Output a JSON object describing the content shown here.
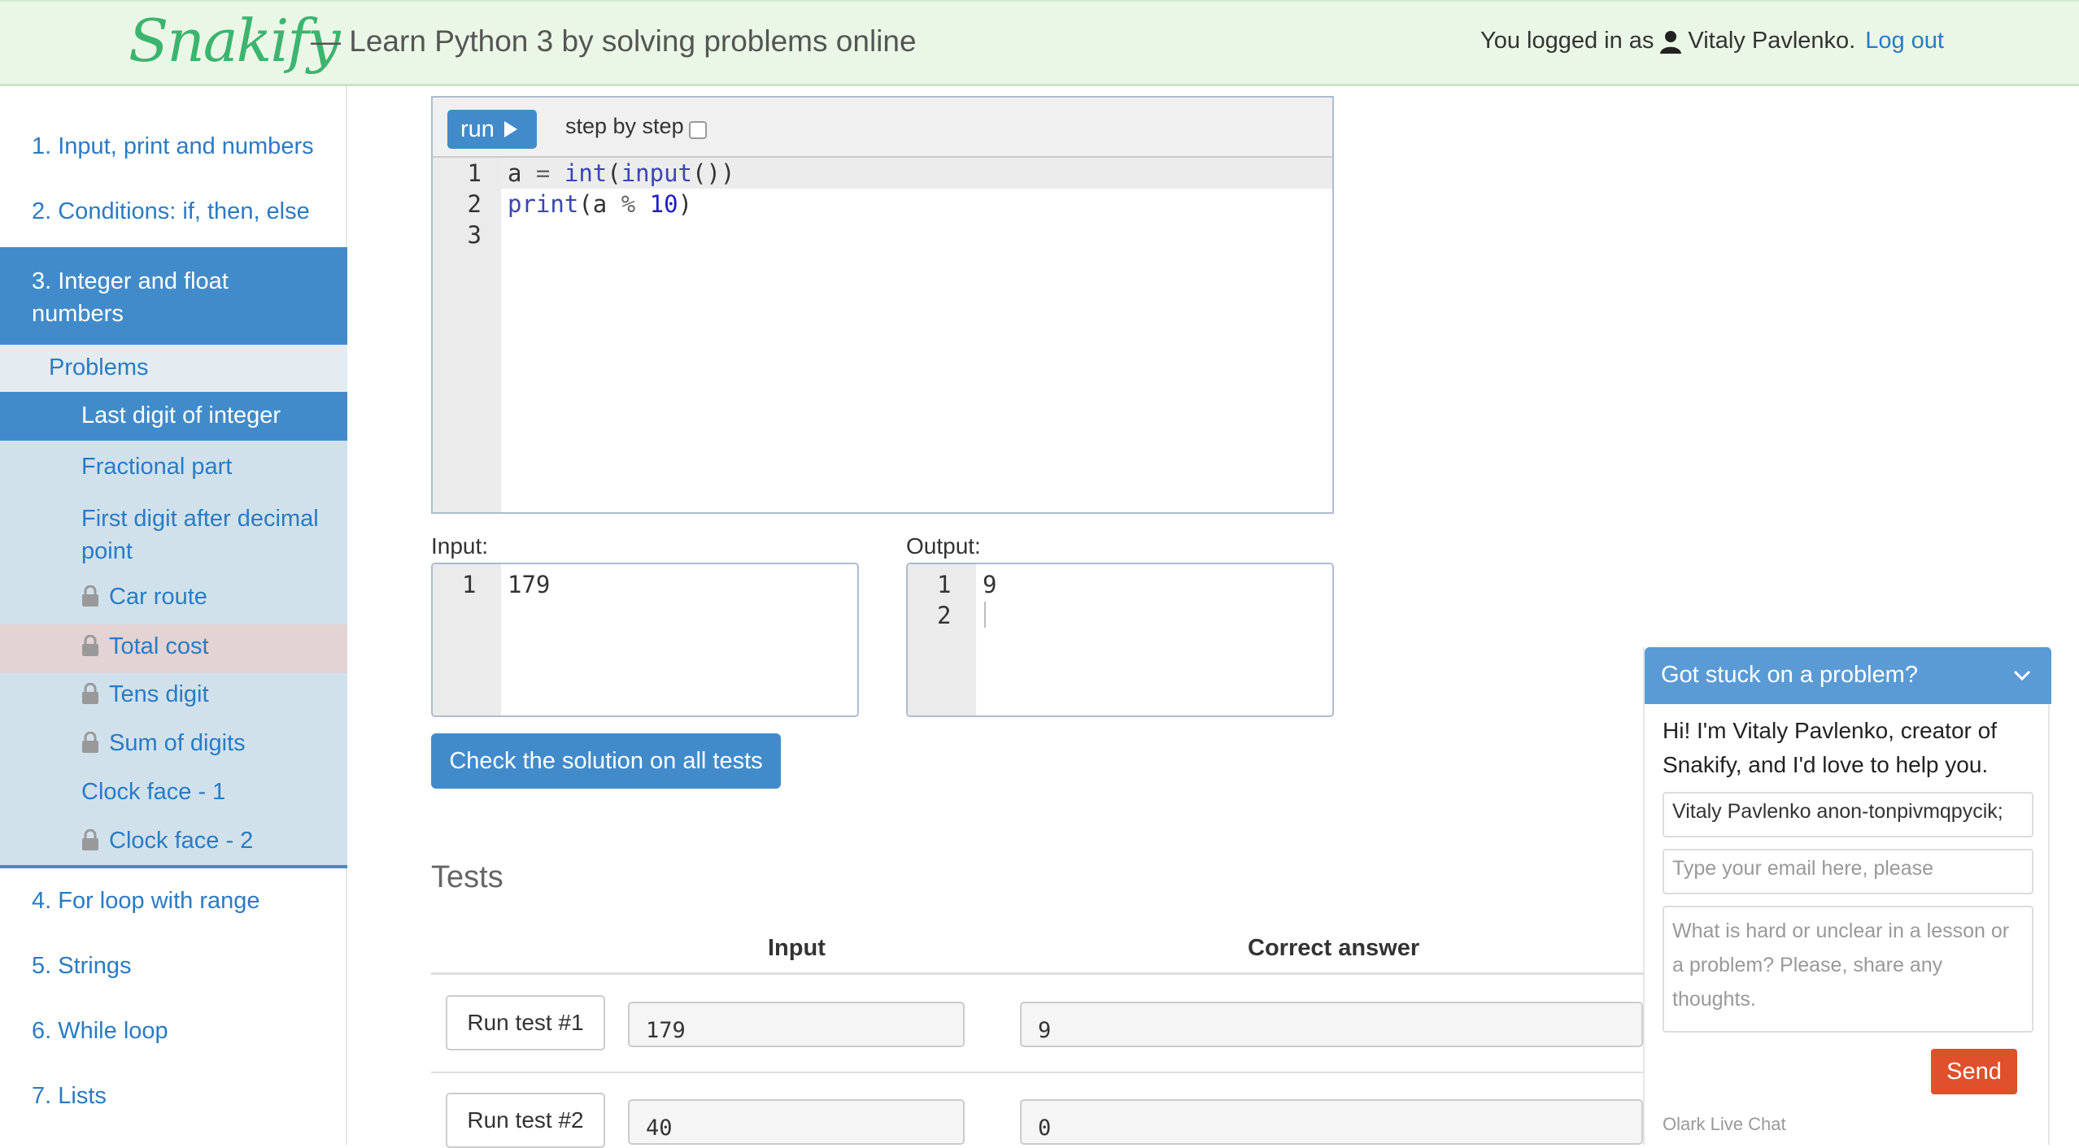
{
  "header": {
    "logo": "Snakify",
    "tagline": "— Learn Python 3 by solving problems online",
    "login_prefix": "You logged in as",
    "user_name": "Vitaly Pavlenko.",
    "logout": "Log out"
  },
  "sidebar": {
    "items": [
      {
        "label": "1. Input, print and numbers"
      },
      {
        "label": "2. Conditions: if, then, else"
      },
      {
        "label": "3. Integer and float numbers"
      },
      {
        "label": "4. For loop with range"
      },
      {
        "label": "5. Strings"
      },
      {
        "label": "6. While loop"
      },
      {
        "label": "7. Lists"
      }
    ],
    "problems_label": "Problems",
    "problems": [
      {
        "label": "Last digit of integer",
        "locked": false
      },
      {
        "label": "Fractional part",
        "locked": false
      },
      {
        "label": "First digit after decimal point",
        "locked": false
      },
      {
        "label": "Car route",
        "locked": true
      },
      {
        "label": "Total cost",
        "locked": true
      },
      {
        "label": "Tens digit",
        "locked": true
      },
      {
        "label": "Sum of digits",
        "locked": true
      },
      {
        "label": "Clock face - 1",
        "locked": false
      },
      {
        "label": "Clock face - 2",
        "locked": true
      }
    ]
  },
  "editor": {
    "run_label": "run",
    "step_label": "step by step",
    "line_numbers": [
      "1",
      "2",
      "3"
    ],
    "code_lines": [
      "a = int(input())",
      "print(a % 10)",
      ""
    ]
  },
  "io": {
    "input_label": "Input:",
    "output_label": "Output:",
    "input_lines": [
      {
        "n": "1",
        "text": "179"
      }
    ],
    "output_lines": [
      {
        "n": "1",
        "text": "9"
      },
      {
        "n": "2",
        "text": ""
      }
    ]
  },
  "check_button": "Check the solution on all tests",
  "tests": {
    "title": "Tests",
    "col_input": "Input",
    "col_answer": "Correct answer",
    "rows": [
      {
        "button": "Run test #1",
        "input": "179",
        "answer": "9"
      },
      {
        "button": "Run test #2",
        "input": "40",
        "answer": "0"
      }
    ]
  },
  "chat": {
    "title": "Got stuck on a problem?",
    "message": "Hi! I'm Vitaly Pavlenko, creator of Snakify, and I'd love to help you.",
    "name_value": "Vitaly Pavlenko anon-tonpivmqpycik;",
    "email_placeholder": "Type your email here, please",
    "message_placeholder": "What is hard or unclear in a lesson or a problem? Please, share any thoughts.",
    "send": "Send",
    "footer": "Olark Live Chat"
  },
  "colors": {
    "accent": "#428bca",
    "header_bg": "#eaf7e6",
    "logo": "#3cb46e",
    "send": "#e0502b",
    "sidebar_sub": "#d0e1ec"
  }
}
